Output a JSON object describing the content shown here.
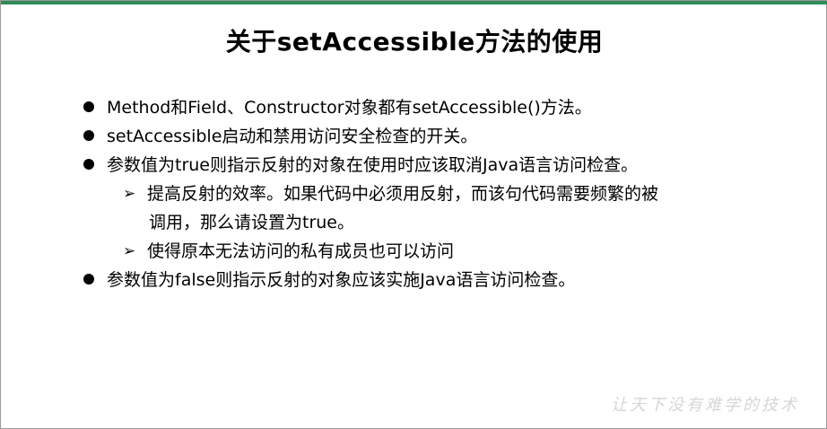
{
  "slide": {
    "title": "关于setAccessible方法的使用",
    "items": [
      {
        "level": 1,
        "text": "Method和Field、Constructor对象都有setAccessible()方法。"
      },
      {
        "level": 1,
        "text": "setAccessible启动和禁用访问安全检查的开关。"
      },
      {
        "level": 1,
        "text": "参数值为true则指示反射的对象在使用时应该取消Java语言访问检查。"
      },
      {
        "level": 2,
        "text": "提高反射的效率。如果代码中必须用反射，而该句代码需要频繁的被",
        "continuation": "调用，那么请设置为true。"
      },
      {
        "level": 2,
        "text": "使得原本无法访问的私有成员也可以访问"
      },
      {
        "level": 1,
        "text": "参数值为false则指示反射的对象应该实施Java语言访问检查。"
      }
    ],
    "watermark": "让天下没有难学的技术"
  }
}
